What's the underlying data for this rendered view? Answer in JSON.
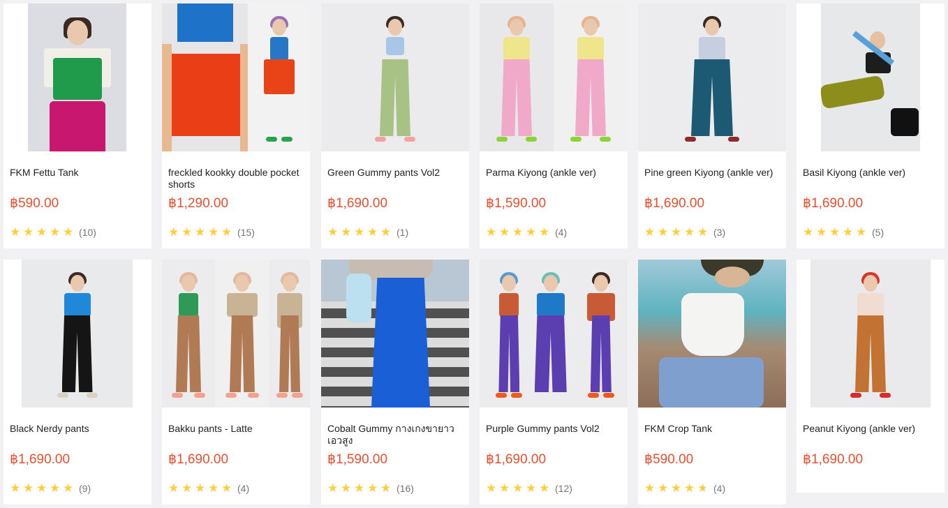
{
  "currency_symbol": "฿",
  "accent_price_color": "#ee4d2d",
  "star_color": "#ffce3d",
  "star_icon": "star-icon",
  "products": [
    {
      "title": "FKM Fettu Tank",
      "price": "฿590.00",
      "stars": 5,
      "review_count": "(10)"
    },
    {
      "title": "freckled kookky double pocket shorts",
      "price": "฿1,290.00",
      "stars": 5,
      "review_count": "(15)"
    },
    {
      "title": "Green Gummy pants Vol2",
      "price": "฿1,690.00",
      "stars": 5,
      "review_count": "(1)"
    },
    {
      "title": "Parma Kiyong (ankle ver)",
      "price": "฿1,590.00",
      "stars": 5,
      "review_count": "(4)"
    },
    {
      "title": "Pine green Kiyong (ankle ver)",
      "price": "฿1,690.00",
      "stars": 5,
      "review_count": "(3)"
    },
    {
      "title": "Basil Kiyong (ankle ver)",
      "price": "฿1,690.00",
      "stars": 5,
      "review_count": "(5)"
    },
    {
      "title": "Black Nerdy pants",
      "price": "฿1,690.00",
      "stars": 5,
      "review_count": "(9)"
    },
    {
      "title": "Bakku pants - Latte",
      "price": "฿1,690.00",
      "stars": 5,
      "review_count": "(4)"
    },
    {
      "title": "Cobalt Gummy กางเกงขายาวเอวสูง",
      "price": "฿1,590.00",
      "stars": 5,
      "review_count": "(16)"
    },
    {
      "title": "Purple Gummy pants Vol2",
      "price": "฿1,690.00",
      "stars": 5,
      "review_count": "(12)"
    },
    {
      "title": "FKM Crop Tank",
      "price": "฿590.00",
      "stars": 4.5,
      "review_count": "(4)"
    },
    {
      "title": "Peanut Kiyong (ankle ver)",
      "price": "฿1,690.00",
      "stars": null,
      "review_count": ""
    }
  ]
}
